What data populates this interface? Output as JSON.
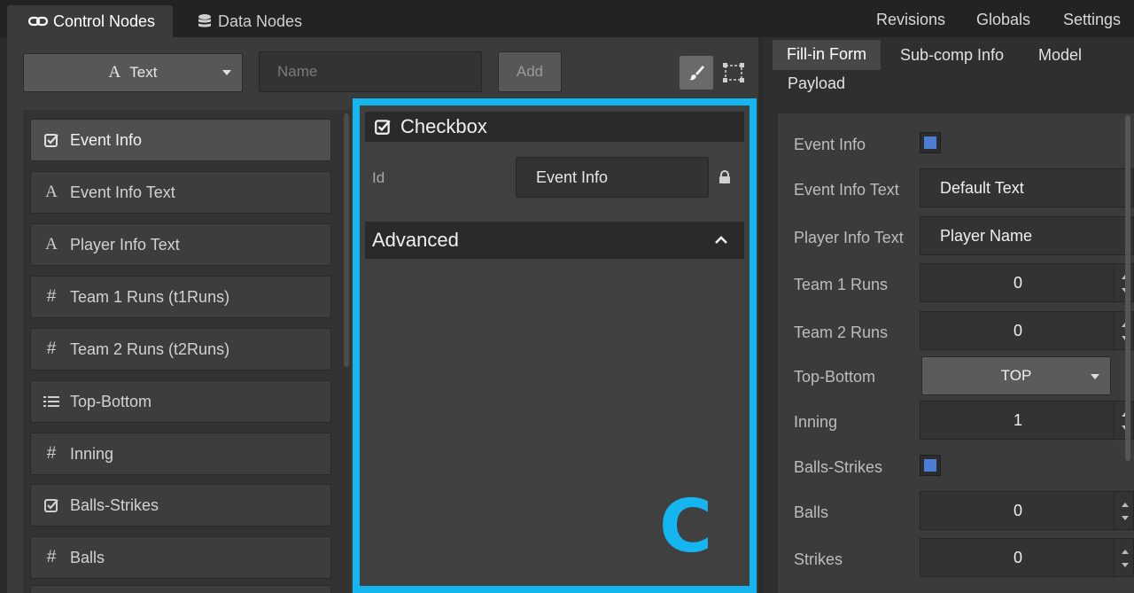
{
  "top_tabs": [
    {
      "label": "Control Nodes",
      "icon": "link-icon",
      "active": true
    },
    {
      "label": "Data Nodes",
      "icon": "database-icon",
      "active": false
    }
  ],
  "top_links": [
    "Revisions",
    "Globals",
    "Settings"
  ],
  "toolbar": {
    "type_button_label": "Text",
    "name_placeholder": "Name",
    "add_label": "Add"
  },
  "nodes": [
    {
      "label": "Event Info",
      "icon": "checkbox-icon",
      "selected": true
    },
    {
      "label": "Event Info Text",
      "icon": "text-icon"
    },
    {
      "label": "Player Info Text",
      "icon": "text-icon"
    },
    {
      "label": "Team 1 Runs (t1Runs)",
      "icon": "number-icon"
    },
    {
      "label": "Team 2 Runs (t2Runs)",
      "icon": "number-icon"
    },
    {
      "label": "Top-Bottom",
      "icon": "list-icon"
    },
    {
      "label": "Inning",
      "icon": "number-icon"
    },
    {
      "label": "Balls-Strikes",
      "icon": "checkbox-icon"
    },
    {
      "label": "Balls",
      "icon": "number-icon"
    }
  ],
  "property_panel": {
    "title": "Checkbox",
    "id_label": "Id",
    "id_value": "Event Info",
    "advanced_label": "Advanced",
    "callout_letter": "C",
    "callout_color": "#15b5f0"
  },
  "right_tabs": {
    "fill_in_form": "Fill-in Form",
    "sub_comp_info": "Sub-comp Info",
    "model": "Model",
    "payload": "Payload"
  },
  "form": {
    "event_info_label": "Event Info",
    "event_info_text_label": "Event Info Text",
    "event_info_text_value": "Default Text",
    "player_info_text_label": "Player Info Text",
    "player_info_text_value": "Player Name",
    "team1_runs_label": "Team 1 Runs",
    "team1_runs_value": "0",
    "team2_runs_label": "Team 2 Runs",
    "team2_runs_value": "0",
    "top_bottom_label": "Top-Bottom",
    "top_bottom_value": "TOP",
    "inning_label": "Inning",
    "inning_value": "1",
    "balls_strikes_label": "Balls-Strikes",
    "balls_label": "Balls",
    "balls_value": "0",
    "strikes_label": "Strikes",
    "strikes_value": "0"
  }
}
